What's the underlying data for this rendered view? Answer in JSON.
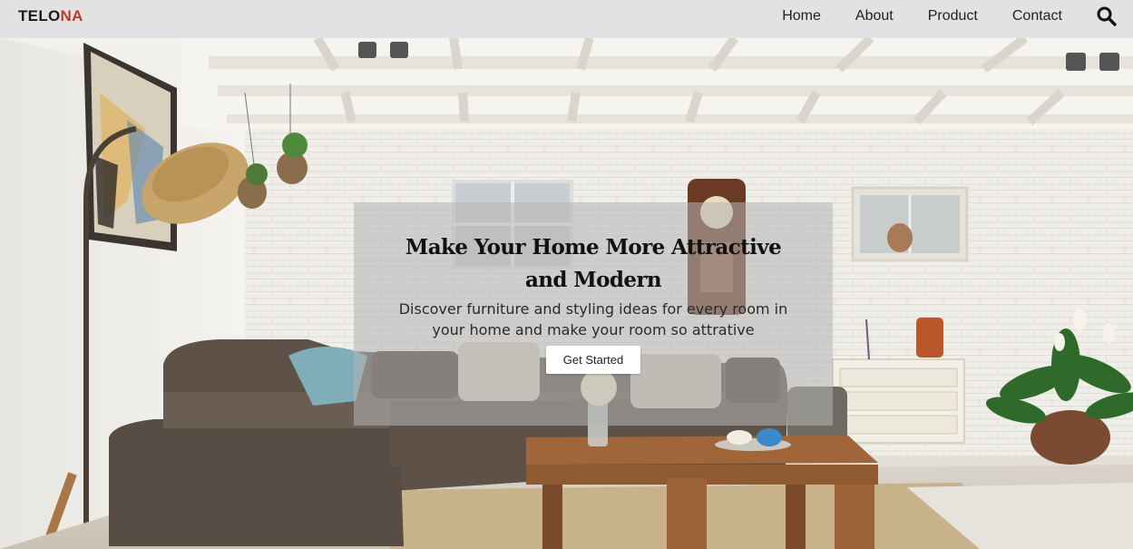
{
  "brand": {
    "part1": "TELO",
    "part2": "NA",
    "accent_color": "#c0392b"
  },
  "nav": {
    "items": [
      {
        "label": "Home"
      },
      {
        "label": "About"
      },
      {
        "label": "Product"
      },
      {
        "label": "Contact"
      }
    ],
    "search_icon": "search-icon"
  },
  "hero": {
    "headline": "Make Your Home More Attractive and Modern",
    "subtext": "Discover furniture and styling ideas for every room in your home and make your room so attrative",
    "cta_label": "Get Started"
  }
}
